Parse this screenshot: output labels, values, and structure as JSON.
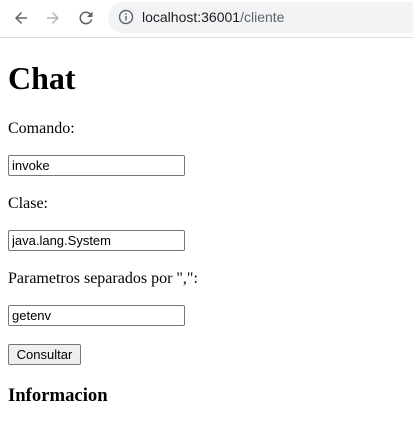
{
  "browser": {
    "url_host": "localhost:36001",
    "url_path": "/cliente",
    "icons": {
      "back": "arrow-left-icon",
      "forward": "arrow-right-icon",
      "reload": "reload-icon",
      "site_info": "info-icon"
    }
  },
  "page": {
    "title": "Chat",
    "form": {
      "command_label": "Comando:",
      "command_value": "invoke",
      "class_label": "Clase:",
      "class_value": "java.lang.System",
      "params_label": "Parametros separados por \",\":",
      "params_value": "getenv",
      "submit_label": "Consultar"
    },
    "info_heading": "Informacion"
  }
}
